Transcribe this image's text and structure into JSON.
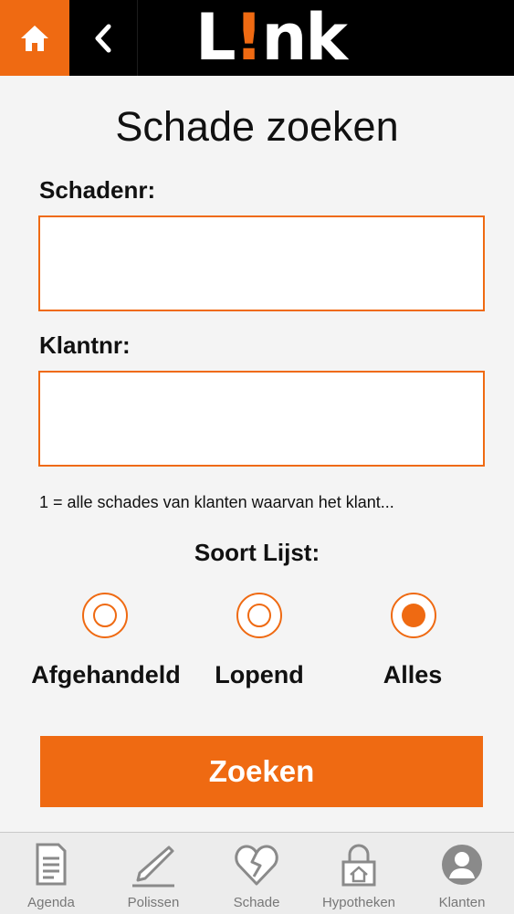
{
  "header": {
    "home_icon": "home-icon",
    "back_icon": "back-chevron-icon",
    "logo_text_1": "L",
    "logo_text_2": "!",
    "logo_text_3": "nk"
  },
  "page": {
    "title": "Schade zoeken",
    "schadenr_label": "Schadenr:",
    "schadenr_value": "",
    "klantnr_label": "Klantnr:",
    "klantnr_value": "",
    "hint": "1 = alle schades van klanten waarvan het klant...",
    "list_title": "Soort Lijst:",
    "options": [
      {
        "label": "Afgehandeld",
        "selected": false
      },
      {
        "label": "Lopend",
        "selected": false
      },
      {
        "label": "Alles",
        "selected": true
      }
    ],
    "search_label": "Zoeken"
  },
  "tabs": [
    {
      "label": "Agenda",
      "icon": "document-icon"
    },
    {
      "label": "Polissen",
      "icon": "pen-icon"
    },
    {
      "label": "Schade",
      "icon": "broken-heart-icon"
    },
    {
      "label": "Hypotheken",
      "icon": "lock-house-icon"
    },
    {
      "label": "Klanten",
      "icon": "person-icon"
    }
  ],
  "colors": {
    "accent": "#ef6a12",
    "header_bg": "#000000",
    "page_bg": "#f4f4f4"
  }
}
